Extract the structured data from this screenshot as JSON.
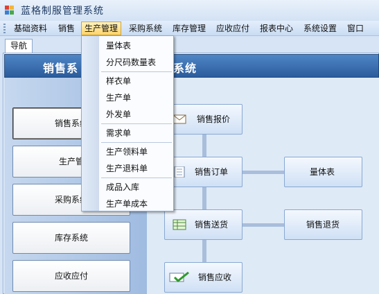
{
  "window": {
    "title": "蓝格制服管理系统",
    "icon": "app-icon"
  },
  "menubar": {
    "items": [
      "基础资料",
      "销售",
      "生产管理",
      "采购系统",
      "库存管理",
      "应收应付",
      "报表中心",
      "系统设置",
      "窗口"
    ],
    "active": "生产管理"
  },
  "tabs": [
    {
      "label": "导航"
    }
  ],
  "banner": {
    "title_part1": "销售系",
    "title_part2": "系统"
  },
  "left_buttons": [
    "销售系统",
    "生产管",
    "采购系统",
    "库存系统",
    "应收应付"
  ],
  "flow": {
    "quote": "销售报价",
    "order": "销售订单",
    "delivery": "销售送货",
    "receivable": "销售应收",
    "measure": "量体表",
    "return": "销售退货"
  },
  "dropdown": {
    "items": [
      "量体表",
      "分尺码数量表",
      "样衣单",
      "生产单",
      "外发单",
      "需求单",
      "生产领料单",
      "生产退料单",
      "成品入库",
      "生产单成本"
    ]
  },
  "colors": {
    "banner": "#3a6fb0",
    "menu_active": "#ffd56a",
    "accent": "#2b5c9c"
  }
}
